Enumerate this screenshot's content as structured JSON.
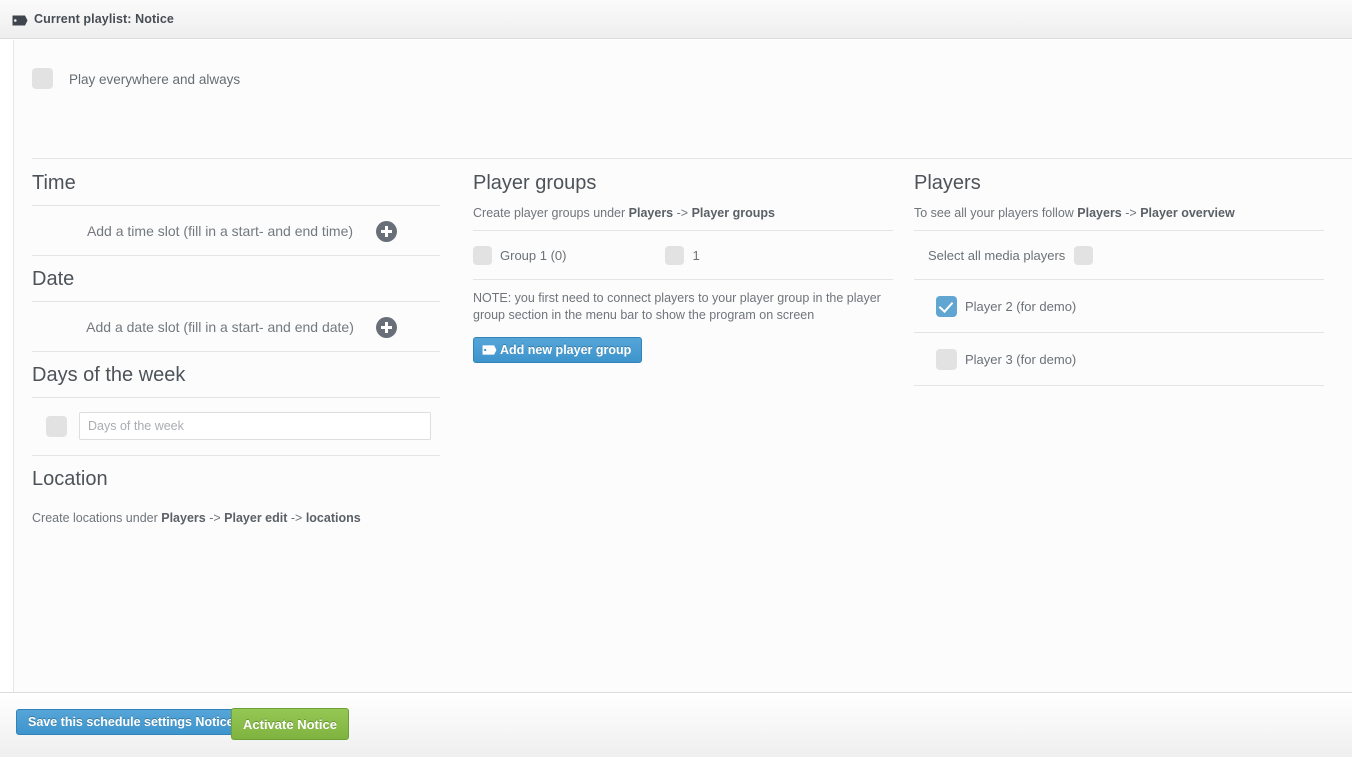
{
  "topbar": {
    "icon": "tag-icon",
    "title": "Current playlist: Notice"
  },
  "play_everywhere": {
    "label": "Play everywhere and always",
    "checked": false
  },
  "left_column": {
    "time": {
      "heading": "Time",
      "add_label": "Add a time slot (fill in a start- and end time)",
      "add_icon": "plus-circle-icon"
    },
    "date": {
      "heading": "Date",
      "add_label": "Add a date slot (fill in a start- and end date)",
      "add_icon": "plus-circle-icon"
    },
    "days_of_week": {
      "heading": "Days of the week",
      "checked": false,
      "input_value": "",
      "input_placeholder": "Days of the week"
    },
    "location": {
      "heading": "Location",
      "note_prefix": "Create locations under ",
      "note_link1": "Players",
      "note_sep1": " -> ",
      "note_link2": "Player edit",
      "note_sep2": " -> ",
      "note_link3": "locations"
    }
  },
  "middle_column": {
    "heading": "Player groups",
    "sub_prefix": "Create player groups under ",
    "sub_link1": "Players",
    "sub_sep": " -> ",
    "sub_link2": "Player groups",
    "groups": [
      {
        "label": "Group 1 (0)",
        "checked": false
      },
      {
        "label": "1",
        "checked": false
      }
    ],
    "note": "NOTE: you first need to connect players to your player group in the player group section in the menu bar to show the program on screen",
    "add_button": {
      "label": "Add new player group",
      "icon": "tag-icon",
      "color": "#3d95cc"
    }
  },
  "right_column": {
    "heading": "Players",
    "sub_prefix": "To see all your players follow ",
    "sub_link1": "Players",
    "sub_sep": " -> ",
    "sub_link2": "Player overview",
    "select_all": {
      "label": "Select all media players",
      "checked": false
    },
    "players": [
      {
        "label": "Player 2 (for demo)",
        "checked": true
      },
      {
        "label": "Player 3 (for demo)",
        "checked": false
      }
    ]
  },
  "footer": {
    "save_label": "Save this schedule settings Notice",
    "save_color": "#3d95cc",
    "activate_label": "Activate Notice",
    "activate_color": "#7fb33f"
  }
}
